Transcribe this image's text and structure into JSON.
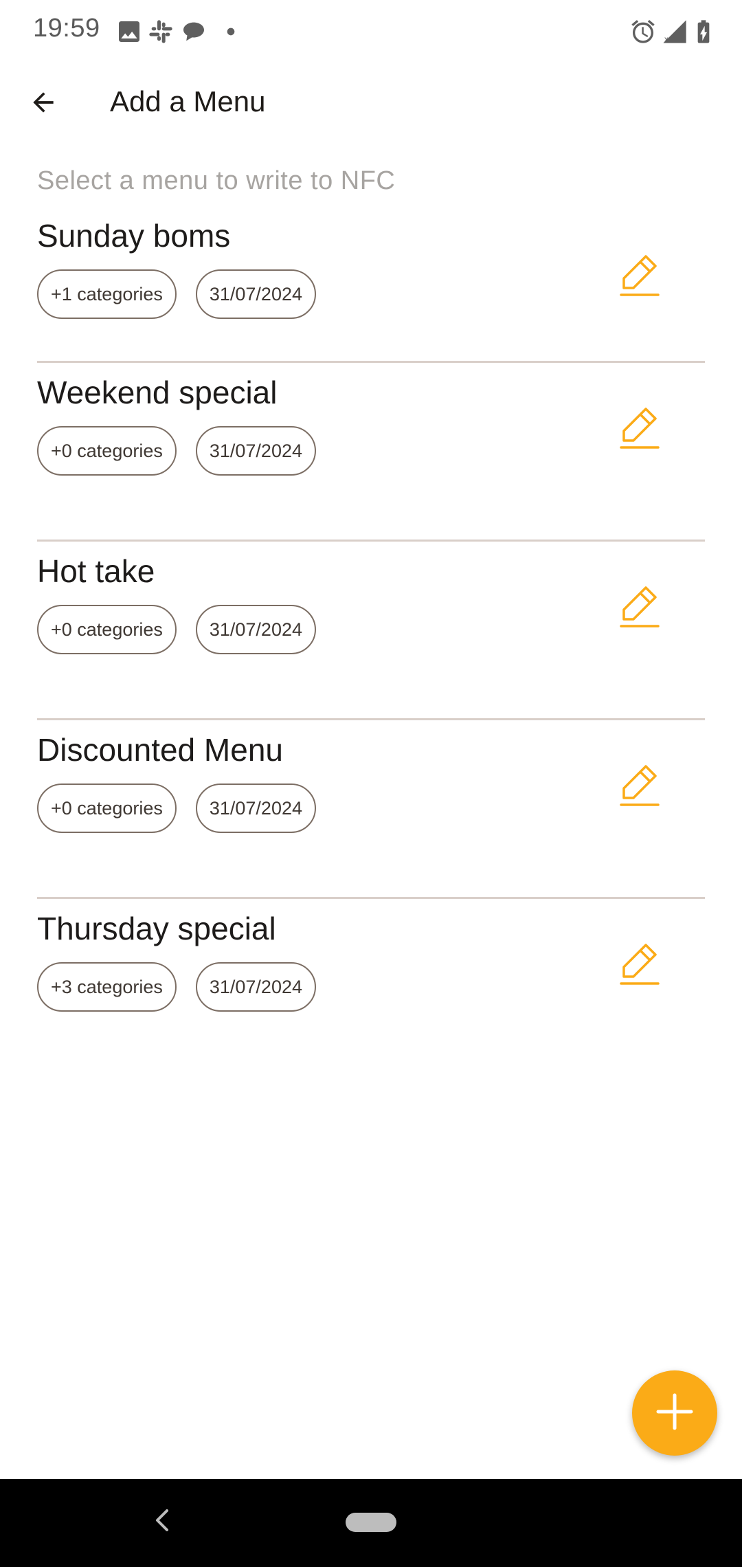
{
  "status_bar": {
    "time": "19:59",
    "left_icons": [
      "image-icon",
      "slack-icon",
      "chat-bubble-icon",
      "dot-icon"
    ],
    "right_icons": [
      "alarm-icon",
      "signal-icon",
      "battery-charging-icon"
    ]
  },
  "app_bar": {
    "title": "Add a Menu",
    "back_icon": "arrow-back-icon"
  },
  "subtitle": "Select a menu to write to NFC",
  "menus": [
    {
      "name": "Sunday boms",
      "categories": "+1 categories",
      "date": "31/07/2024"
    },
    {
      "name": "Weekend special",
      "categories": "+0 categories",
      "date": "31/07/2024"
    },
    {
      "name": "Hot take",
      "categories": "+0 categories",
      "date": "31/07/2024"
    },
    {
      "name": "Discounted Menu",
      "categories": "+0 categories",
      "date": "31/07/2024"
    },
    {
      "name": "Thursday special",
      "categories": "+3 categories",
      "date": "31/07/2024"
    }
  ],
  "fab": {
    "icon": "plus-icon"
  },
  "colors": {
    "accent": "#fbab17",
    "chip_border": "#7c6e64",
    "divider": "#d9cfc9",
    "subtitle": "#a7a4a1"
  }
}
